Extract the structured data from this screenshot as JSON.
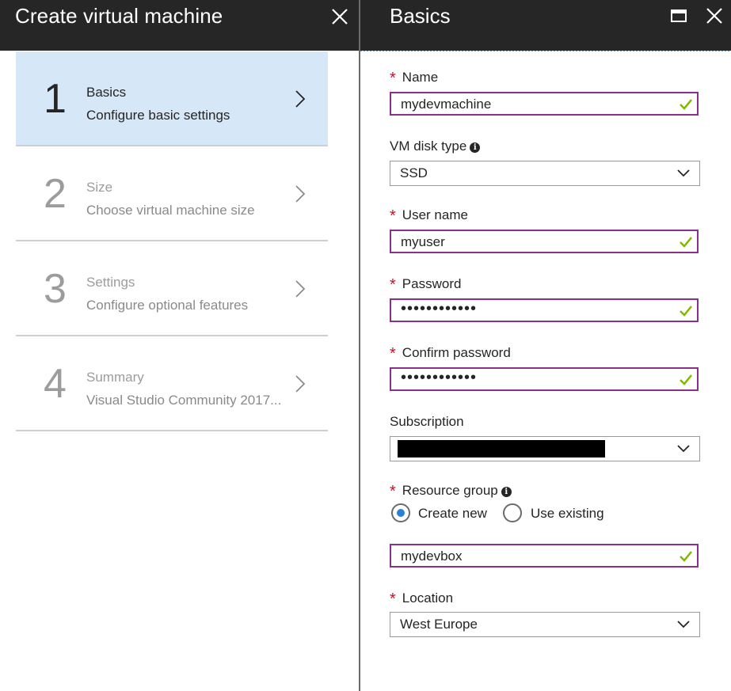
{
  "left_blade": {
    "title": "Create virtual machine",
    "steps": [
      {
        "number": "1",
        "title": "Basics",
        "subtitle": "Configure basic settings",
        "active": true
      },
      {
        "number": "2",
        "title": "Size",
        "subtitle": "Choose virtual machine size",
        "active": false
      },
      {
        "number": "3",
        "title": "Settings",
        "subtitle": "Configure optional features",
        "active": false
      },
      {
        "number": "4",
        "title": "Summary",
        "subtitle": "Visual Studio Community 2017...",
        "active": false
      }
    ]
  },
  "right_blade": {
    "title": "Basics",
    "fields": {
      "name": {
        "label": "Name",
        "required": true,
        "value": "mydevmachine",
        "valid": true
      },
      "vm_disk_type": {
        "label": "VM disk type",
        "value": "SSD"
      },
      "user_name": {
        "label": "User name",
        "required": true,
        "value": "myuser",
        "valid": true
      },
      "password": {
        "label": "Password",
        "required": true,
        "value": "••••••••••••",
        "valid": true
      },
      "confirm_password": {
        "label": "Confirm password",
        "required": true,
        "value": "••••••••••••",
        "valid": true
      },
      "subscription": {
        "label": "Subscription",
        "value": "",
        "redacted": true
      },
      "resource_group": {
        "label": "Resource group",
        "required": true,
        "option_create_new": "Create new",
        "option_use_existing": "Use existing",
        "selected": "Create new",
        "value": "mydevbox",
        "valid": true
      },
      "location": {
        "label": "Location",
        "required": true,
        "value": "West Europe"
      }
    }
  },
  "icons": {
    "close": "close-icon",
    "maximize": "maximize-icon",
    "chevron_right": "chevron-right-icon",
    "chevron_down": "chevron-down-icon",
    "checkmark": "checkmark-icon",
    "info": "info-icon"
  },
  "colors": {
    "header_bg": "#262626",
    "active_step_bg": "#d6e7f7",
    "valid_border": "#8a2f8c",
    "valid_check": "#7fba00",
    "required_star": "#c8102e",
    "radio_selected": "#2a7fd6"
  }
}
